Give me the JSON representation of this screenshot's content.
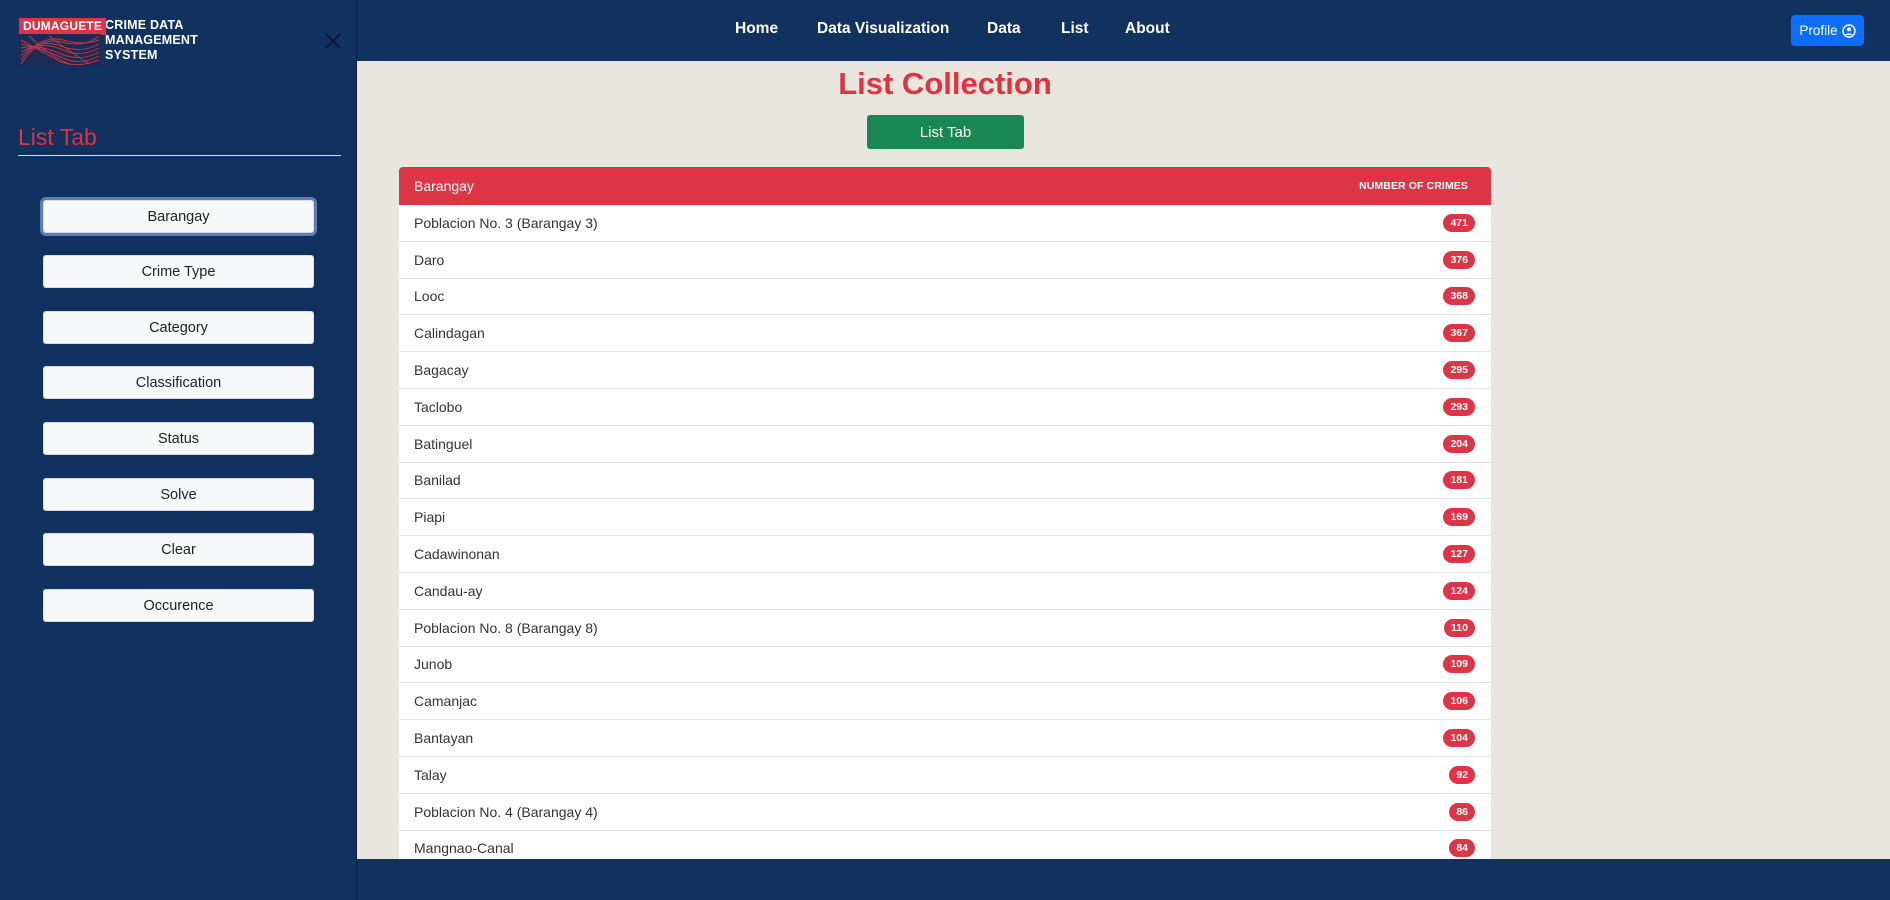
{
  "brand": {
    "tag": "DUMAGUETE",
    "line1": "CRIME DATA",
    "line2": "MANAGEMENT",
    "line3": "SYSTEM"
  },
  "sidebar": {
    "title": "List Tab",
    "buttons": [
      {
        "label": "Barangay"
      },
      {
        "label": "Crime Type"
      },
      {
        "label": "Category"
      },
      {
        "label": "Classification"
      },
      {
        "label": "Status"
      },
      {
        "label": "Solve"
      },
      {
        "label": "Clear"
      },
      {
        "label": "Occurence"
      }
    ]
  },
  "nav": {
    "items": [
      {
        "label": "Home"
      },
      {
        "label": "Data Visualization"
      },
      {
        "label": "Data"
      },
      {
        "label": "List"
      },
      {
        "label": "About"
      }
    ],
    "profile_label": "Profile"
  },
  "main": {
    "title": "List Collection",
    "tab_button": "List Tab",
    "table": {
      "col_left": "Barangay",
      "col_right": "NUMBER OF CRIMES",
      "rows": [
        {
          "name": "Poblacion No. 3 (Barangay 3)",
          "count": "471"
        },
        {
          "name": "Daro",
          "count": "376"
        },
        {
          "name": "Looc",
          "count": "368"
        },
        {
          "name": "Calindagan",
          "count": "367"
        },
        {
          "name": "Bagacay",
          "count": "295"
        },
        {
          "name": "Taclobo",
          "count": "293"
        },
        {
          "name": "Batinguel",
          "count": "204"
        },
        {
          "name": "Banilad",
          "count": "181"
        },
        {
          "name": "Piapi",
          "count": "169"
        },
        {
          "name": "Cadawinonan",
          "count": "127"
        },
        {
          "name": "Candau-ay",
          "count": "124"
        },
        {
          "name": "Poblacion No. 8 (Barangay 8)",
          "count": "110"
        },
        {
          "name": "Junob",
          "count": "109"
        },
        {
          "name": "Camanjac",
          "count": "106"
        },
        {
          "name": "Bantayan",
          "count": "104"
        },
        {
          "name": "Talay",
          "count": "92"
        },
        {
          "name": "Poblacion No. 4 (Barangay 4)",
          "count": "86"
        },
        {
          "name": "Mangnao-Canal",
          "count": "84"
        }
      ]
    }
  },
  "colors": {
    "navy": "#11325f",
    "accent_red": "#dc3545",
    "green": "#198754",
    "blue": "#0d6efd",
    "background": "#e9e5df"
  },
  "icons": {
    "close": "close-icon",
    "profile": "user-circle-icon",
    "logo": "fingerprint-icon"
  }
}
